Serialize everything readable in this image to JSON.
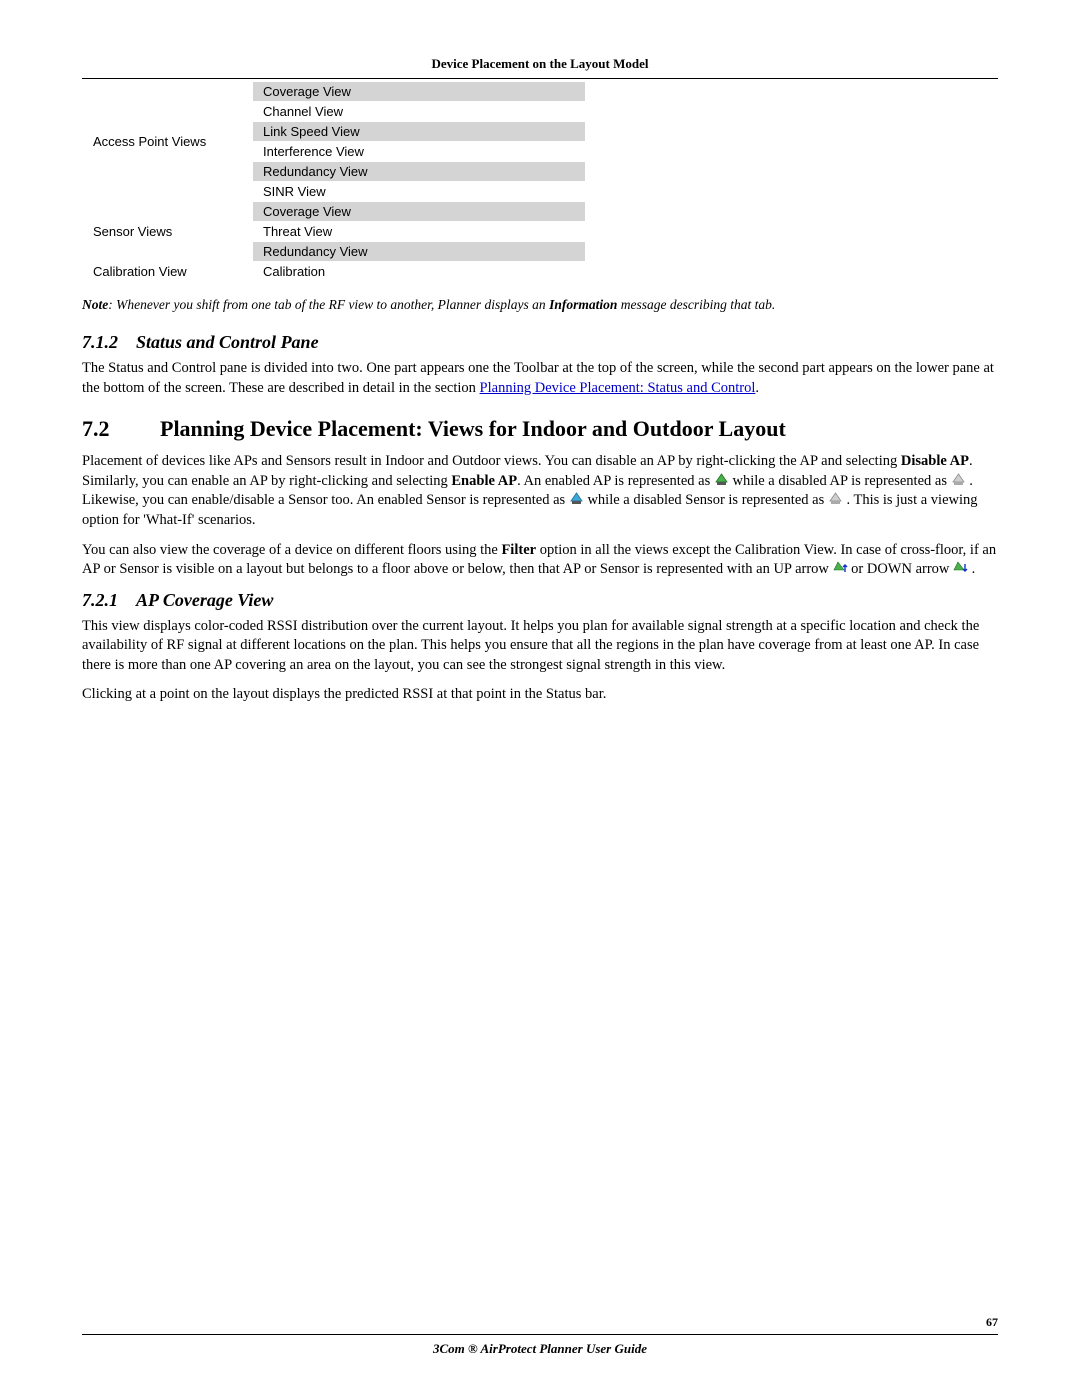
{
  "header": {
    "running_head": "Device Placement on the Layout Model"
  },
  "table": {
    "rows": [
      {
        "cat": "Access Point Views",
        "vals": [
          "Coverage View",
          "Channel View",
          "Link Speed View",
          "Interference View",
          "Redundancy View",
          "SINR View"
        ]
      },
      {
        "cat": "Sensor Views",
        "vals": [
          "Coverage View",
          "Threat View",
          "Redundancy View"
        ]
      },
      {
        "cat": "Calibration View",
        "vals": [
          "Calibration"
        ]
      }
    ]
  },
  "note": {
    "label": "Note",
    "body_pre": ": Whenever you shift from one tab of the RF view to another, Planner displays an ",
    "info": "Information",
    "body_post": " message describing that tab."
  },
  "s712": {
    "num": "7.1.2",
    "title": "Status and Control Pane",
    "para_pre": "The Status and Control pane is divided into two. One part appears one the Toolbar at the top of the screen, while the second part appears on the lower pane at the bottom of the screen. These are described in detail in the section ",
    "link": "Planning Device Placement: Status and Control",
    "para_post": "."
  },
  "s72": {
    "num": "7.2",
    "title": "Planning Device Placement: Views for Indoor and Outdoor Layout",
    "p1a": "Placement of devices like APs and Sensors result in Indoor and Outdoor views. You can disable an AP by right-clicking the AP and selecting ",
    "b1": "Disable AP",
    "p1b": ". Similarly, you can enable an AP by right-clicking and selecting ",
    "b2": "Enable AP",
    "p1c": ". An enabled AP is represented as ",
    "p1d": " while a disabled AP is represented as ",
    "p1e": ". Likewise, you can enable/disable a Sensor too. An enabled Sensor is represented as ",
    "p1f": " while a disabled Sensor is represented as ",
    "p1g": ". This is just a viewing option for 'What-If' scenarios.",
    "p2a": "You can also view the coverage of a device on different floors using the ",
    "b3": "Filter",
    "p2b": " option in all the views except the Calibration View. In case of cross-floor, if an AP or Sensor is visible on a layout but belongs to a floor above or below, then that AP or Sensor is represented with an UP arrow ",
    "p2c": " or DOWN arrow ",
    "p2d": "."
  },
  "s721": {
    "num": "7.2.1",
    "title": "AP Coverage View",
    "p1": "This view displays color-coded RSSI distribution over the current layout. It helps you plan for available signal strength at a specific location and check the availability of RF signal at different locations on the plan. This helps you ensure that all the regions in the plan have coverage from at least one AP. In case there is more than one AP covering an area on the layout, you can see the strongest signal strength in this view.",
    "p2": "Clicking at a point on the layout displays the predicted RSSI at that point in the Status bar."
  },
  "footer": {
    "page": "67",
    "guide": "3Com ® AirProtect Planner User Guide"
  },
  "icons": {
    "ap_enabled": "ap-enabled-icon",
    "ap_disabled": "ap-disabled-icon",
    "sensor_enabled": "sensor-enabled-icon",
    "sensor_disabled": "sensor-disabled-icon",
    "up_arrow": "device-up-arrow-icon",
    "down_arrow": "device-down-arrow-icon"
  }
}
